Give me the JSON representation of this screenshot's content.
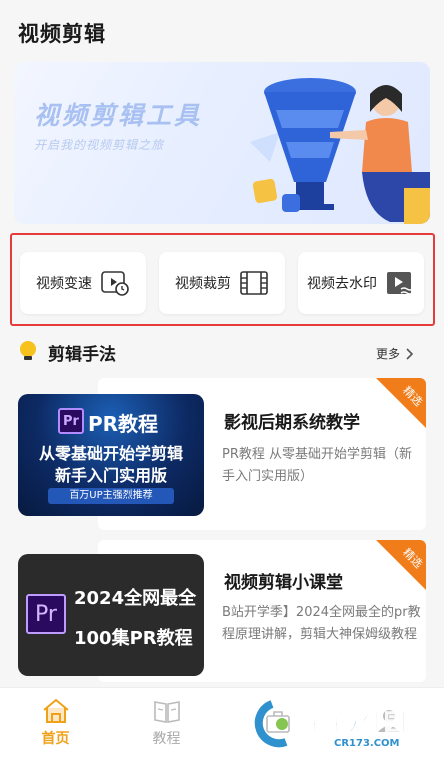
{
  "header": {
    "title": "视频剪辑"
  },
  "banner": {
    "title": "视频剪辑工具",
    "subtitle": "开启我的视频剪辑之旅"
  },
  "tools": [
    {
      "label": "视频变速",
      "icon": "speed-icon"
    },
    {
      "label": "视频裁剪",
      "icon": "film-icon"
    },
    {
      "label": "视频去水印",
      "icon": "watermark-remove-icon"
    }
  ],
  "section": {
    "title": "剪辑手法",
    "more": "更多"
  },
  "courses": [
    {
      "title": "影视后期系统教学",
      "desc": "PR教程 从零基础开始学剪辑（新手入门实用版）",
      "tag": "精选",
      "thumb": {
        "title": "PR教程",
        "line1": "从零基础开始学剪辑",
        "line2": "新手入门实用版",
        "badge": "百万UP主强烈推荐",
        "logo": "Pr"
      }
    },
    {
      "title": "视频剪辑小课堂",
      "desc": "B站开学季】2024全网最全的pr教程原理讲解，剪辑大神保姆级教程",
      "tag": "精选",
      "thumb": {
        "line1": "2024全网最全",
        "line2": "100集PR教程",
        "logo": "Pr"
      }
    }
  ],
  "nav": [
    {
      "label": "首页",
      "icon": "home-icon",
      "active": true
    },
    {
      "label": "教程",
      "icon": "book-icon",
      "active": false
    },
    {
      "label": "",
      "icon": "toolbox-icon",
      "active": false
    },
    {
      "label": "",
      "icon": "user-icon",
      "active": false
    }
  ],
  "watermark": {
    "text": "西西软件园",
    "url": "CR173.COM"
  },
  "colors": {
    "accent": "#f0a11a",
    "highlight_frame": "#e63b3b",
    "tag": "#f07c1a"
  }
}
